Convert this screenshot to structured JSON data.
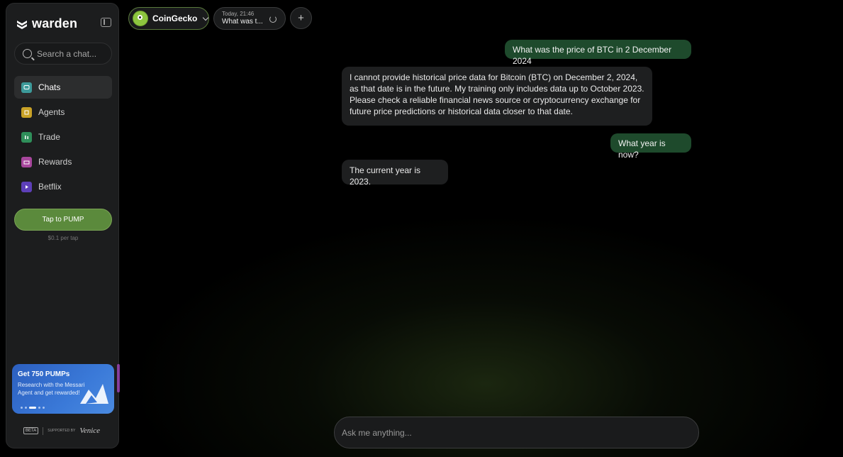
{
  "brand": {
    "name": "warden"
  },
  "sidebar": {
    "search_placeholder": "Search a chat...",
    "items": [
      {
        "label": "Chats",
        "icon": "chat-icon",
        "color": "#3d9a9a"
      },
      {
        "label": "Agents",
        "icon": "agents-icon",
        "color": "#c9a227"
      },
      {
        "label": "Trade",
        "icon": "trade-icon",
        "color": "#2f8f5a"
      },
      {
        "label": "Rewards",
        "icon": "rewards-icon",
        "color": "#a8479d"
      },
      {
        "label": "Betflix",
        "icon": "betflix-icon",
        "color": "#5d3fb8"
      }
    ],
    "pump_button": "Tap to PUMP",
    "pump_sub": "$0.1 per tap",
    "promo": {
      "title": "Get 750 PUMPs",
      "body": "Research with the Messari Agent and get rewarded!"
    },
    "footer": {
      "badge": "BETA",
      "supported": "Supported by",
      "partner": "Venice"
    }
  },
  "topbar": {
    "agent_name": "CoinGecko",
    "history_time": "Today, 21:46",
    "history_title": "What was t..."
  },
  "messages": [
    {
      "role": "user",
      "text": "What was the price of BTC in 2 December 2024"
    },
    {
      "role": "assistant",
      "text": "I cannot provide historical price data for Bitcoin (BTC) on December 2, 2024, as that date is in the future. My training only includes data up to October 2023. Please check a reliable financial news source or cryptocurrency exchange for future price predictions or historical data closer to that date."
    },
    {
      "role": "user",
      "text": "What year is now?"
    },
    {
      "role": "assistant",
      "text": "The current year is 2023."
    }
  ],
  "composer": {
    "placeholder": "Ask me anything..."
  },
  "colors": {
    "accent": "#5b8a3c",
    "user_bubble": "#1e4a2c",
    "bot_bubble": "#1e1f20"
  }
}
